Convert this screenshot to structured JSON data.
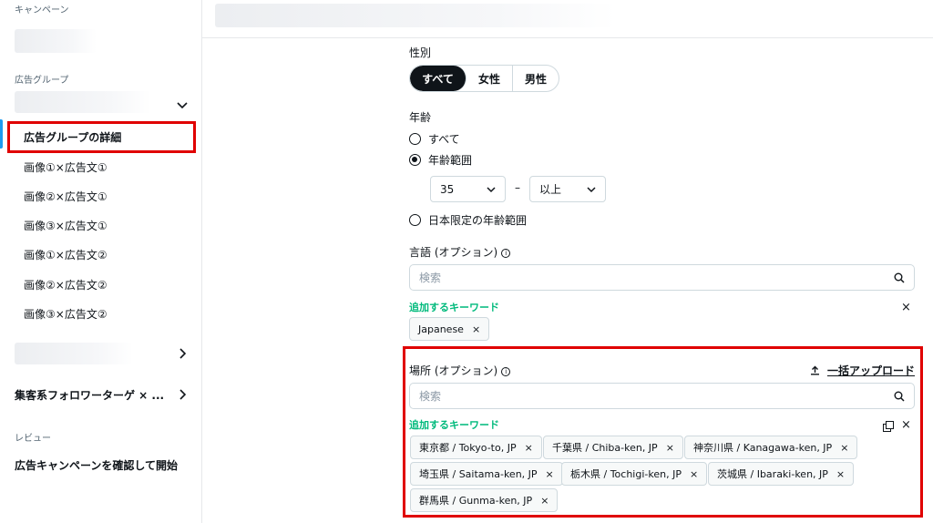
{
  "sidebar": {
    "campaign_label": "キャンペーン",
    "adgroup_label": "広告グループ",
    "adgroup_detail": "広告グループの詳細",
    "ads": [
      "画像①×広告文①",
      "画像②×広告文①",
      "画像③×広告文①",
      "画像①×広告文②",
      "画像②×広告文②",
      "画像③×広告文②"
    ],
    "other_group": "集客系フォロワーターゲ × ...",
    "review_label": "レビュー",
    "review_item": "広告キャンペーンを確認して開始"
  },
  "gender": {
    "label": "性別",
    "options": [
      "すべて",
      "女性",
      "男性"
    ],
    "selected": "すべて"
  },
  "age": {
    "label": "年齢",
    "options": [
      "すべて",
      "年齢範囲",
      "日本限定の年齢範囲"
    ],
    "selected": "年齢範囲",
    "min": "35",
    "max": "以上",
    "dash": "–"
  },
  "language": {
    "label": "言語 (オプション)",
    "search_placeholder": "検索",
    "keyword_label": "追加するキーワード",
    "chips": [
      "Japanese"
    ]
  },
  "location": {
    "label": "場所 (オプション)",
    "bulk_upload": "一括アップロード",
    "search_placeholder": "検索",
    "keyword_label": "追加するキーワード",
    "chips": [
      "東京都 / Tokyo-to, JP",
      "千葉県 / Chiba-ken, JP",
      "神奈川県 / Kanagawa-ken, JP",
      "埼玉県 / Saitama-ken, JP",
      "栃木県 / Tochigi-ken, JP",
      "茨城県 / Ibaraki-ken, JP",
      "群馬県 / Gunma-ken, JP"
    ]
  },
  "icons": {
    "chevron_down": "⌄",
    "chevron_right": "›",
    "close": "×",
    "search": "search-icon",
    "upload": "upload-icon",
    "info": "i"
  },
  "colors": {
    "accent_green": "#00ba7c",
    "highlight_red": "#e00000",
    "active_blue": "#1d9bf0"
  }
}
